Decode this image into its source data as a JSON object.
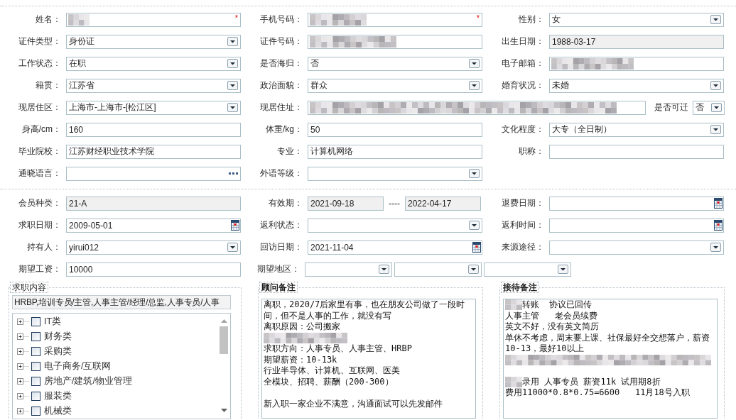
{
  "personal": {
    "rows": [
      [
        {
          "label": "姓名：",
          "kind": "blurred",
          "mark": "*"
        },
        {
          "label": "手机号码：",
          "kind": "blurred",
          "mark": "*"
        },
        {
          "label": "性别：",
          "kind": "select",
          "value": "女"
        }
      ],
      [
        {
          "label": "证件类型：",
          "kind": "select",
          "value": "身份证"
        },
        {
          "label": "证件号码：",
          "kind": "blurred"
        },
        {
          "label": "出生日期：",
          "kind": "readonly",
          "value": "1988-03-17"
        }
      ],
      [
        {
          "label": "工作状态：",
          "kind": "select",
          "value": "在职"
        },
        {
          "label": "是否海归：",
          "kind": "select",
          "value": "否"
        },
        {
          "label": "电子邮箱：",
          "kind": "blurred"
        }
      ],
      [
        {
          "label": "籍贯：",
          "kind": "select",
          "value": "江苏省"
        },
        {
          "label": "政治面貌：",
          "kind": "select",
          "value": "群众"
        },
        {
          "label": "婚育状况：",
          "kind": "select",
          "value": "未婚"
        }
      ],
      [
        {
          "label": "现居住区：",
          "kind": "select",
          "value": "上海市-上海市-[松江区]"
        },
        {
          "label": "现居住址：",
          "kind": "blurred",
          "suffix": {
            "label": "是否可迁",
            "kind": "select",
            "value": "否"
          }
        }
      ],
      [
        {
          "label": "身高/cm：",
          "kind": "text",
          "value": "160"
        },
        {
          "label": "体重/kg：",
          "kind": "text",
          "value": "50"
        },
        {
          "label": "文化程度：",
          "kind": "select",
          "value": "大专（全日制）"
        }
      ],
      [
        {
          "label": "毕业院校：",
          "kind": "text",
          "value": "江苏财经职业技术学院"
        },
        {
          "label": "专业：",
          "kind": "text",
          "value": "计算机网络"
        },
        {
          "label": "职称：",
          "kind": "text"
        }
      ],
      [
        {
          "label": "通晓语言：",
          "kind": "lookup"
        },
        {
          "label": "外语等级：",
          "kind": "select"
        }
      ]
    ]
  },
  "membership": {
    "rows": [
      [
        {
          "label": "会员种类：",
          "kind": "readonly",
          "value": "21-A"
        },
        {
          "label": "有效期：",
          "kind": "range",
          "from": "2021-09-18",
          "separator": "----",
          "to": "2022-04-17"
        },
        {
          "label": "退费日期：",
          "kind": "date"
        }
      ],
      [
        {
          "label": "求职日期：",
          "kind": "date",
          "value": "2009-05-01"
        },
        {
          "label": "返利状态：",
          "kind": "select"
        },
        {
          "label": "返利时间：",
          "kind": "date"
        }
      ],
      [
        {
          "label": "持有人：",
          "kind": "select",
          "value": "yirui012"
        },
        {
          "label": "回访日期：",
          "kind": "date",
          "value": "2021-11-04"
        },
        {
          "label": "来源途径：",
          "kind": "select"
        }
      ],
      [
        {
          "label": "期望工资：",
          "kind": "text",
          "value": "10000"
        },
        {
          "label": "期望地区：",
          "kind": "select_group",
          "selects": [
            {
              "kind": "select"
            },
            {
              "kind": "select"
            },
            {
              "kind": "select"
            }
          ]
        }
      ]
    ]
  },
  "panels": [
    {
      "kind": "tree",
      "legend": "求职内容",
      "summary": "HRBP,培训专员/主管,人事主管/经理/总监,人事专员/人事",
      "items": [
        {
          "label": "IT类",
          "expanded": false,
          "checked": false
        },
        {
          "label": "财务类",
          "expanded": false,
          "checked": false
        },
        {
          "label": "采购类",
          "expanded": false,
          "checked": false
        },
        {
          "label": "电子商务/互联网",
          "expanded": false,
          "checked": false
        },
        {
          "label": "房地产/建筑/物业管理",
          "expanded": false,
          "checked": false
        },
        {
          "label": "服装类",
          "expanded": false,
          "checked": false
        },
        {
          "label": "机械类",
          "expanded": false,
          "checked": false
        }
      ]
    },
    {
      "kind": "notes",
      "legend": "顾问备注",
      "lines": [
        {
          "kind": "text",
          "text": "离职，2020/7后家里有事，也在朋友公司做了一段时"
        },
        {
          "kind": "text",
          "text": "间，但不是人事的工作，就没有写"
        },
        {
          "kind": "text",
          "text": "离职原因：公司搬家"
        },
        {
          "kind": "blurred"
        },
        {
          "kind": "text",
          "text": "求职方向：人事专员、人事主管、HRBP"
        },
        {
          "kind": "text",
          "text": "期望薪资：10-13k"
        },
        {
          "kind": "text",
          "text": "行业半导体、计算机、互联网、医美"
        },
        {
          "kind": "text",
          "text": "全模块、招聘、薪酬（200-300）"
        },
        {
          "kind": "blank"
        },
        {
          "kind": "text",
          "text": "新入职一家企业不满意，沟通面试可以先发邮件"
        }
      ]
    },
    {
      "kind": "notes",
      "legend": "接待备注",
      "lines": [
        {
          "kind": "blurred_prefix",
          "text": "转账  协议已回传"
        },
        {
          "kind": "text",
          "text": "人事主管   老会员续费"
        },
        {
          "kind": "text",
          "text": "英文不好，没有英文简历"
        },
        {
          "kind": "text",
          "text": "单休不考虑，周末要上课、社保最好全交想落户，薪资"
        },
        {
          "kind": "text",
          "text": "10-13，最好10以上"
        },
        {
          "kind": "blurred"
        },
        {
          "kind": "blank"
        },
        {
          "kind": "blurred_prefix",
          "text": "录用 人事专员 薪资11k 试用期8折"
        },
        {
          "kind": "text",
          "text": "费用11000*0.8*0.75=6600   11月18号入职"
        }
      ]
    }
  ]
}
